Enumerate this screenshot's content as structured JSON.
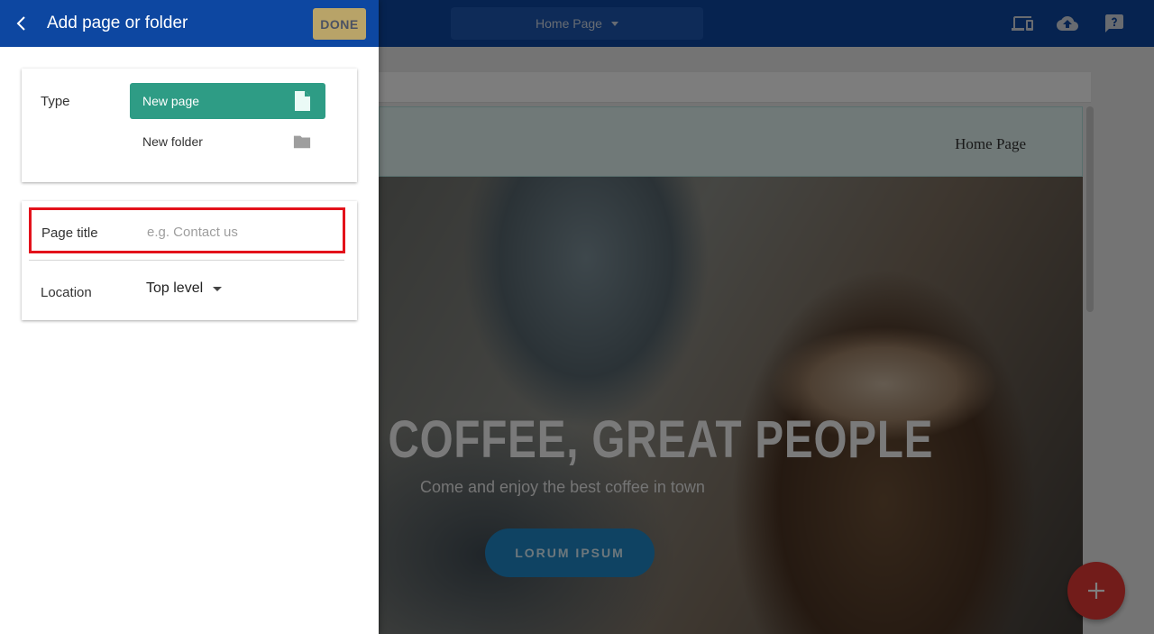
{
  "editor": {
    "page_select": {
      "value": "Home Page"
    },
    "icons": {
      "devices": "devices-icon",
      "publish": "cloud-upload-icon",
      "help": "help-icon"
    },
    "site_nav": {
      "link": "Home Page"
    },
    "hero": {
      "title": "T COFFEE, GREAT PEOPLE",
      "subtitle": "Come and enjoy the best coffee in town",
      "button": "LORUM IPSUM"
    },
    "fab": {
      "icon": "plus-icon"
    }
  },
  "panel": {
    "title": "Add page or folder",
    "back_icon": "chevron-left-icon",
    "done_label": "DONE",
    "type": {
      "label": "Type",
      "options": [
        {
          "label": "New page",
          "icon": "file-icon",
          "selected": true
        },
        {
          "label": "New folder",
          "icon": "folder-icon",
          "selected": false
        }
      ]
    },
    "page_title": {
      "label": "Page title",
      "value": "",
      "placeholder": "e.g. Contact us"
    },
    "location": {
      "label": "Location",
      "value": "Top level"
    }
  },
  "colors": {
    "header_blue": "#0d47a1",
    "selected_option": "#2e9c85",
    "done_button": "#b8a368",
    "highlight_border": "#e3121b",
    "fab": "#e53935"
  }
}
